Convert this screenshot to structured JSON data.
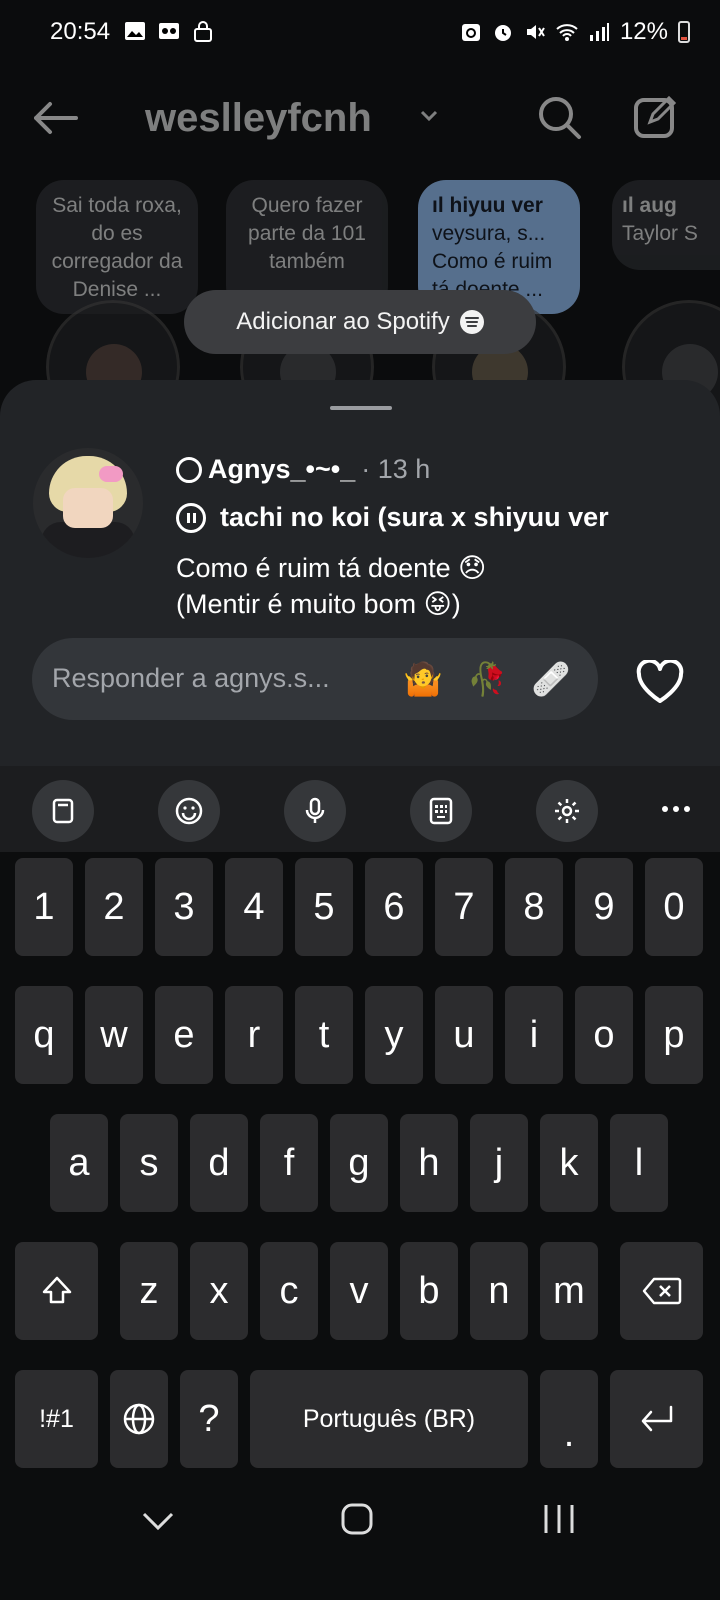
{
  "status_bar": {
    "time": "20:54",
    "battery": "12%"
  },
  "header": {
    "account_name": "weslleyfcnh"
  },
  "notes": [
    {
      "text": "Sai toda roxa, do es corregador da Denise ..."
    },
    {
      "text": "Quero fazer parte da 101 também"
    },
    {
      "title": "hiyuu ver",
      "line1": "veysura, s...",
      "line2": "Como é ruim",
      "line3": "tá doente ..."
    },
    {
      "title": "aug",
      "line1": "Taylor S"
    }
  ],
  "spotify_chip": {
    "label": "Adicionar ao Spotify"
  },
  "note_sheet": {
    "username": "Agnys_•~•_",
    "time_ago": "· 13 h",
    "song": "tachi no koi (sura x shiyuu ver",
    "text_line1": "Como é ruim tá doente 😞",
    "text_line2": "(Mentir é muito bom 😝)",
    "reply_placeholder": "Responder a agnys.s...",
    "quick_reactions": [
      "🤷",
      "🥀",
      "🩹"
    ]
  },
  "keyboard": {
    "row_numbers": [
      "1",
      "2",
      "3",
      "4",
      "5",
      "6",
      "7",
      "8",
      "9",
      "0"
    ],
    "row1": [
      "q",
      "w",
      "e",
      "r",
      "t",
      "y",
      "u",
      "i",
      "o",
      "p"
    ],
    "row2": [
      "a",
      "s",
      "d",
      "f",
      "g",
      "h",
      "j",
      "k",
      "l"
    ],
    "row3": [
      "z",
      "x",
      "c",
      "v",
      "b",
      "n",
      "m"
    ],
    "symbols_label": "!#1",
    "question_key": "?",
    "space_label": "Português (BR)",
    "period_key": "."
  }
}
